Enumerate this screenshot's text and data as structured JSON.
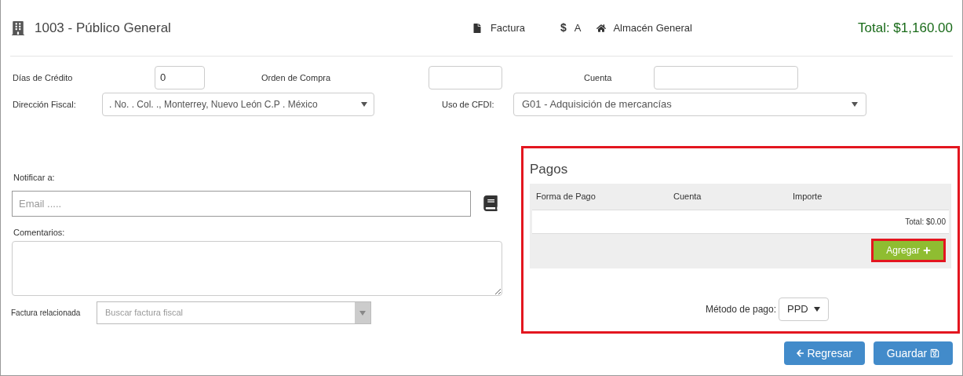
{
  "header": {
    "title": "1003 - Público General",
    "document_type": "Factura",
    "currency_symbol": "$",
    "series": "A",
    "warehouse": "Almacén General",
    "total": "Total: $1,160.00"
  },
  "form": {
    "credit_days": {
      "label": "Días de Crédito",
      "value": "0"
    },
    "purchase_order": {
      "label": "Orden de Compra"
    },
    "account": {
      "label": "Cuenta"
    },
    "fiscal_address": {
      "label": "Dirección Fiscal:",
      "value": ". No. . Col. ., Monterrey, Nuevo León C.P . México"
    },
    "cfdi_use": {
      "label": "Uso de CFDI:",
      "value": "G01 - Adquisición de mercancías"
    }
  },
  "notify": {
    "label": "Notificar a:",
    "placeholder": "Email ....."
  },
  "comments": {
    "label": "Comentarios:"
  },
  "related_invoice": {
    "label": "Factura relacionada",
    "placeholder": "Buscar factura fiscal"
  },
  "payments": {
    "title": "Pagos",
    "columns": [
      "Forma de Pago",
      "Cuenta",
      "Importe"
    ],
    "total": "Total: $0.00",
    "add_button": "Agregar",
    "method_label": "Método de pago:",
    "method_value": "PPD"
  },
  "buttons": [
    {
      "label": "Regresar",
      "kind": "back"
    },
    {
      "label": "Guardar",
      "kind": "save"
    }
  ]
}
